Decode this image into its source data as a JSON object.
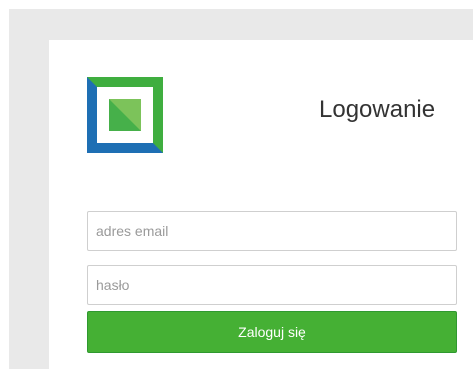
{
  "colors": {
    "frame_bg": "#e9e9e9",
    "card_bg": "#ffffff",
    "logo_blue": "#1e6fb4",
    "logo_green": "#3fae3f",
    "button_green": "#45b034",
    "title_text": "#333333",
    "placeholder_text": "#9a9a9a"
  },
  "logo": {
    "icon": "square-logo-icon"
  },
  "login": {
    "title": "Logowanie",
    "email_placeholder": "adres email",
    "password_placeholder": "hasło",
    "submit_label": "Zaloguj się"
  }
}
